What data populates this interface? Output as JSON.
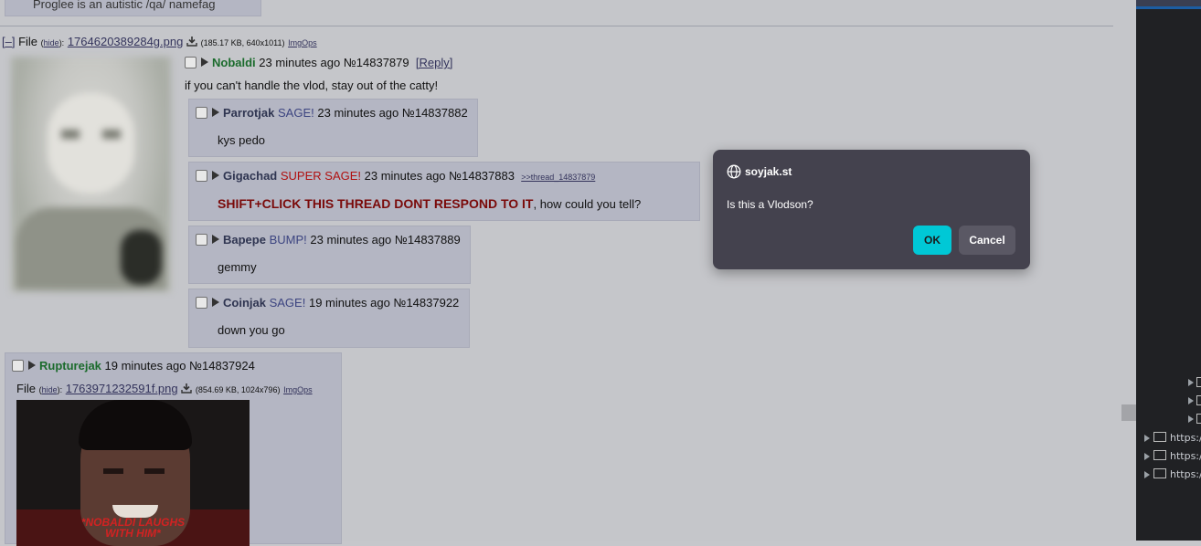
{
  "prev_reply_text": "Proglee is an autistic /qa/ namefag",
  "op": {
    "toggle": "[–]",
    "file_label": "File",
    "hide": "hide",
    "filename": "1764620389284g.png",
    "fileinfo": "(185.17 KB, 640x1011)",
    "imgops": "ImgOps",
    "name": "Nobaldi",
    "time": "23 minutes ago",
    "no": "№14837879",
    "reply": "[Reply]",
    "message": "if you can't handle the vlod, stay out of the catty!"
  },
  "replies": [
    {
      "name": "Parrotjak",
      "tag": "SAGE!",
      "time": "23 minutes ago",
      "no": "№14837882",
      "message": "kys pedo"
    },
    {
      "name": "Gigachad",
      "tag": "SUPER SAGE!",
      "time": "23 minutes ago",
      "no": "№14837883",
      "quote": ">>thread_14837879",
      "message_big": "SHIFT+CLICK THIS THREAD DONT RESPOND TO IT",
      "message_rest": ", how could you tell?"
    },
    {
      "name": "Bapepe",
      "tag": "BUMP!",
      "time": "23 minutes ago",
      "no": "№14837889",
      "message": "gemmy"
    },
    {
      "name": "Coinjak",
      "tag": "SAGE!",
      "time": "19 minutes ago",
      "no": "№14837922",
      "message": "down you go"
    }
  ],
  "last_reply": {
    "name": "Rupturejak",
    "time": "19 minutes ago",
    "no": "№14837924",
    "file_label": "File",
    "hide": "hide",
    "filename": "1763971232591f.png",
    "fileinfo": "(854.69 KB, 1024x796)",
    "imgops": "ImgOps",
    "image_caption_1": "*NOBALDI LAUGHS",
    "image_caption_2": "WITH HIM*"
  },
  "devtools": {
    "rows": [
      "https://",
      "https://",
      "https://"
    ]
  },
  "dialog": {
    "origin": "soyjak.st",
    "message": "Is this a Vlodson?",
    "ok": "OK",
    "cancel": "Cancel",
    "accent": "#00c8d6"
  }
}
